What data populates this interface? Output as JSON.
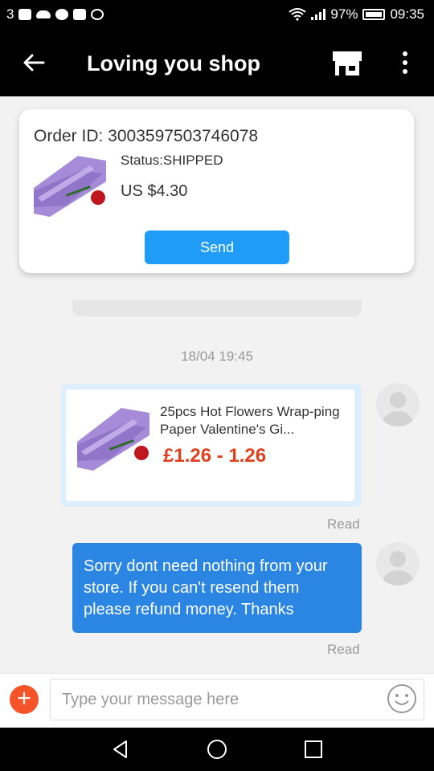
{
  "status_bar": {
    "left_text": "3",
    "battery": "97%",
    "time": "09:35",
    "icons": [
      "mail-icon",
      "cloud-icon",
      "pinterest-icon",
      "youtube-icon",
      "circle-icon",
      "wifi-icon",
      "signal-icon",
      "battery-icon"
    ]
  },
  "header": {
    "title": "Loving you shop",
    "icons": [
      "back-arrow-icon",
      "store-icon",
      "more-vert-icon"
    ]
  },
  "order_card": {
    "order_id": "Order ID: 3003597503746078",
    "status": "Status:SHIPPED",
    "price": "US $4.30",
    "send_label": "Send"
  },
  "chat": {
    "timestamp": "18/04 19:45",
    "product_message": {
      "name": "25pcs Hot Flowers Wrap-ping Paper Valentine's Gi...",
      "price": "£1.26 - 1.26",
      "read_label": "Read"
    },
    "text_message": {
      "text": "Sorry dont need nothing from your store. If you can't resend them please refund  money. Thanks",
      "read_label": "Read"
    }
  },
  "input_bar": {
    "placeholder": "Type your message here",
    "icons": [
      "plus-icon",
      "emoji-icon"
    ]
  },
  "nav_bar": {
    "icons": [
      "nav-back-icon",
      "nav-home-icon",
      "nav-recents-icon"
    ]
  },
  "colors": {
    "send_button": "#1e9cf7",
    "text_bubble": "#2a85e3",
    "price": "#e0401c",
    "plus_button": "#f5542a"
  }
}
